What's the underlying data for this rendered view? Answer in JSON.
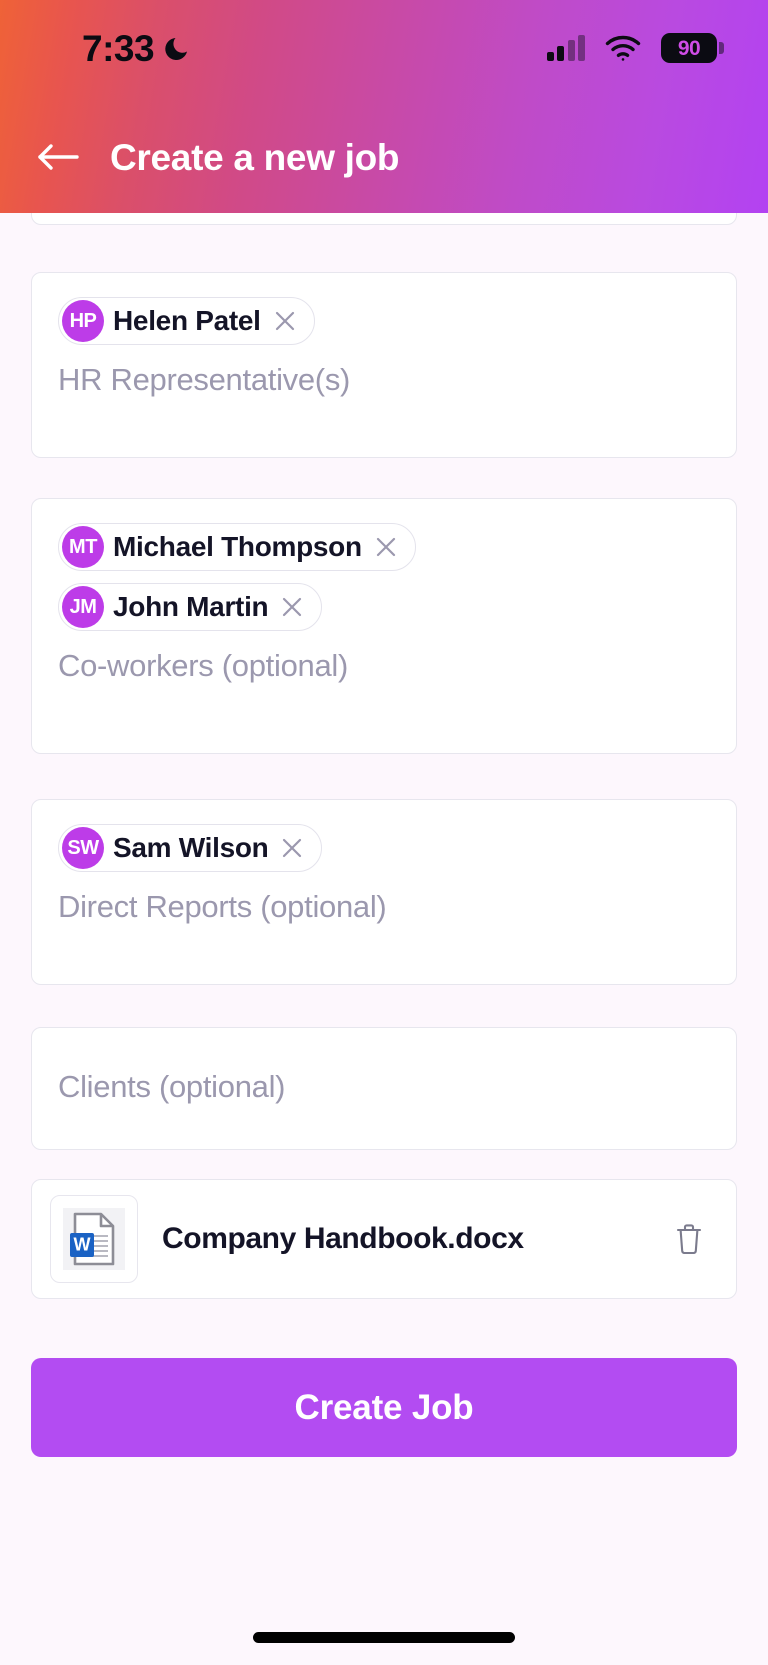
{
  "status_bar": {
    "time": "7:33",
    "moon_icon": "moon-crescent-icon",
    "signal_icon": "cellular-signal-icon",
    "wifi_icon": "wifi-icon",
    "battery_level": "90",
    "battery_icon": "battery-icon"
  },
  "header": {
    "back_icon": "arrow-left-icon",
    "title": "Create a new job",
    "gradient_start": "#ef6237",
    "gradient_end": "#b342f2"
  },
  "theme": {
    "accent": "#b34cf2",
    "avatar_bg": "#bd3ce8",
    "page_bg": "#fdf7fd",
    "card_border": "#e7e6ee",
    "placeholder_color": "#9b98ae",
    "text_color": "#141427"
  },
  "fields": [
    {
      "name": "hr-representatives",
      "placeholder": "HR Representative(s)",
      "chips": [
        {
          "initials": "HP",
          "name": "Helen Patel"
        }
      ]
    },
    {
      "name": "co-workers",
      "placeholder": "Co-workers (optional)",
      "chips": [
        {
          "initials": "MT",
          "name": "Michael Thompson"
        },
        {
          "initials": "JM",
          "name": "John Martin"
        }
      ]
    },
    {
      "name": "direct-reports",
      "placeholder": "Direct Reports (optional)",
      "chips": [
        {
          "initials": "SW",
          "name": "Sam Wilson"
        }
      ]
    },
    {
      "name": "clients",
      "placeholder": "Clients (optional)",
      "chips": []
    }
  ],
  "attachment": {
    "file_name": "Company Handbook.docx",
    "file_type_icon": "word-document-icon",
    "delete_icon": "trash-icon"
  },
  "cta": {
    "label": "Create Job"
  }
}
